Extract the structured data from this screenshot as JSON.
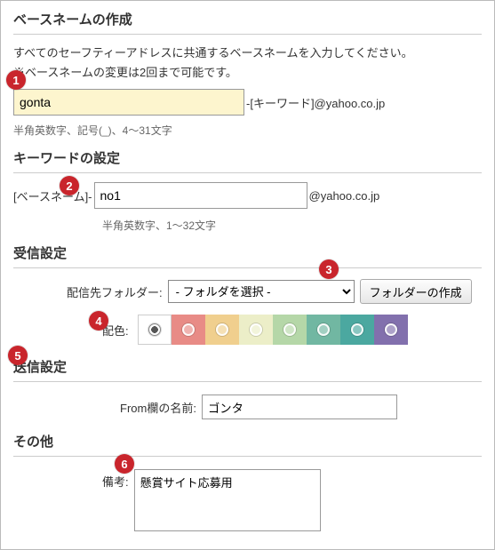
{
  "basename": {
    "title": "ベースネームの作成",
    "desc": "すべてのセーフティーアドレスに共通するベースネームを入力してください。",
    "note": "※ベースネームの変更は2回まで可能です。",
    "value": "gonta",
    "after": "-[キーワード]@yahoo.co.jp",
    "hint": "半角英数字、記号(_)、4～31文字"
  },
  "keyword": {
    "title": "キーワードの設定",
    "prefix": "[ベースネーム]-",
    "value": "no1",
    "after": "@yahoo.co.jp",
    "hint": "半角英数字、1～32文字"
  },
  "receive": {
    "title": "受信設定",
    "folder_label": "配信先フォルダー:",
    "folder_selected": "- フォルダを選択 -",
    "create_btn": "フォルダーの作成",
    "color_label": "配色:",
    "colors": [
      "none",
      "#e88b86",
      "#f0cf8e",
      "#eceec8",
      "#b5d7a8",
      "#71b7a2",
      "#4ba8a0",
      "#8270ad"
    ]
  },
  "send": {
    "title": "送信設定",
    "from_label": "From欄の名前:",
    "from_value": "ゴンタ"
  },
  "other": {
    "title": "その他",
    "memo_label": "備考:",
    "memo_value": "懸賞サイト応募用"
  },
  "badges": [
    "1",
    "2",
    "3",
    "4",
    "5",
    "6"
  ]
}
